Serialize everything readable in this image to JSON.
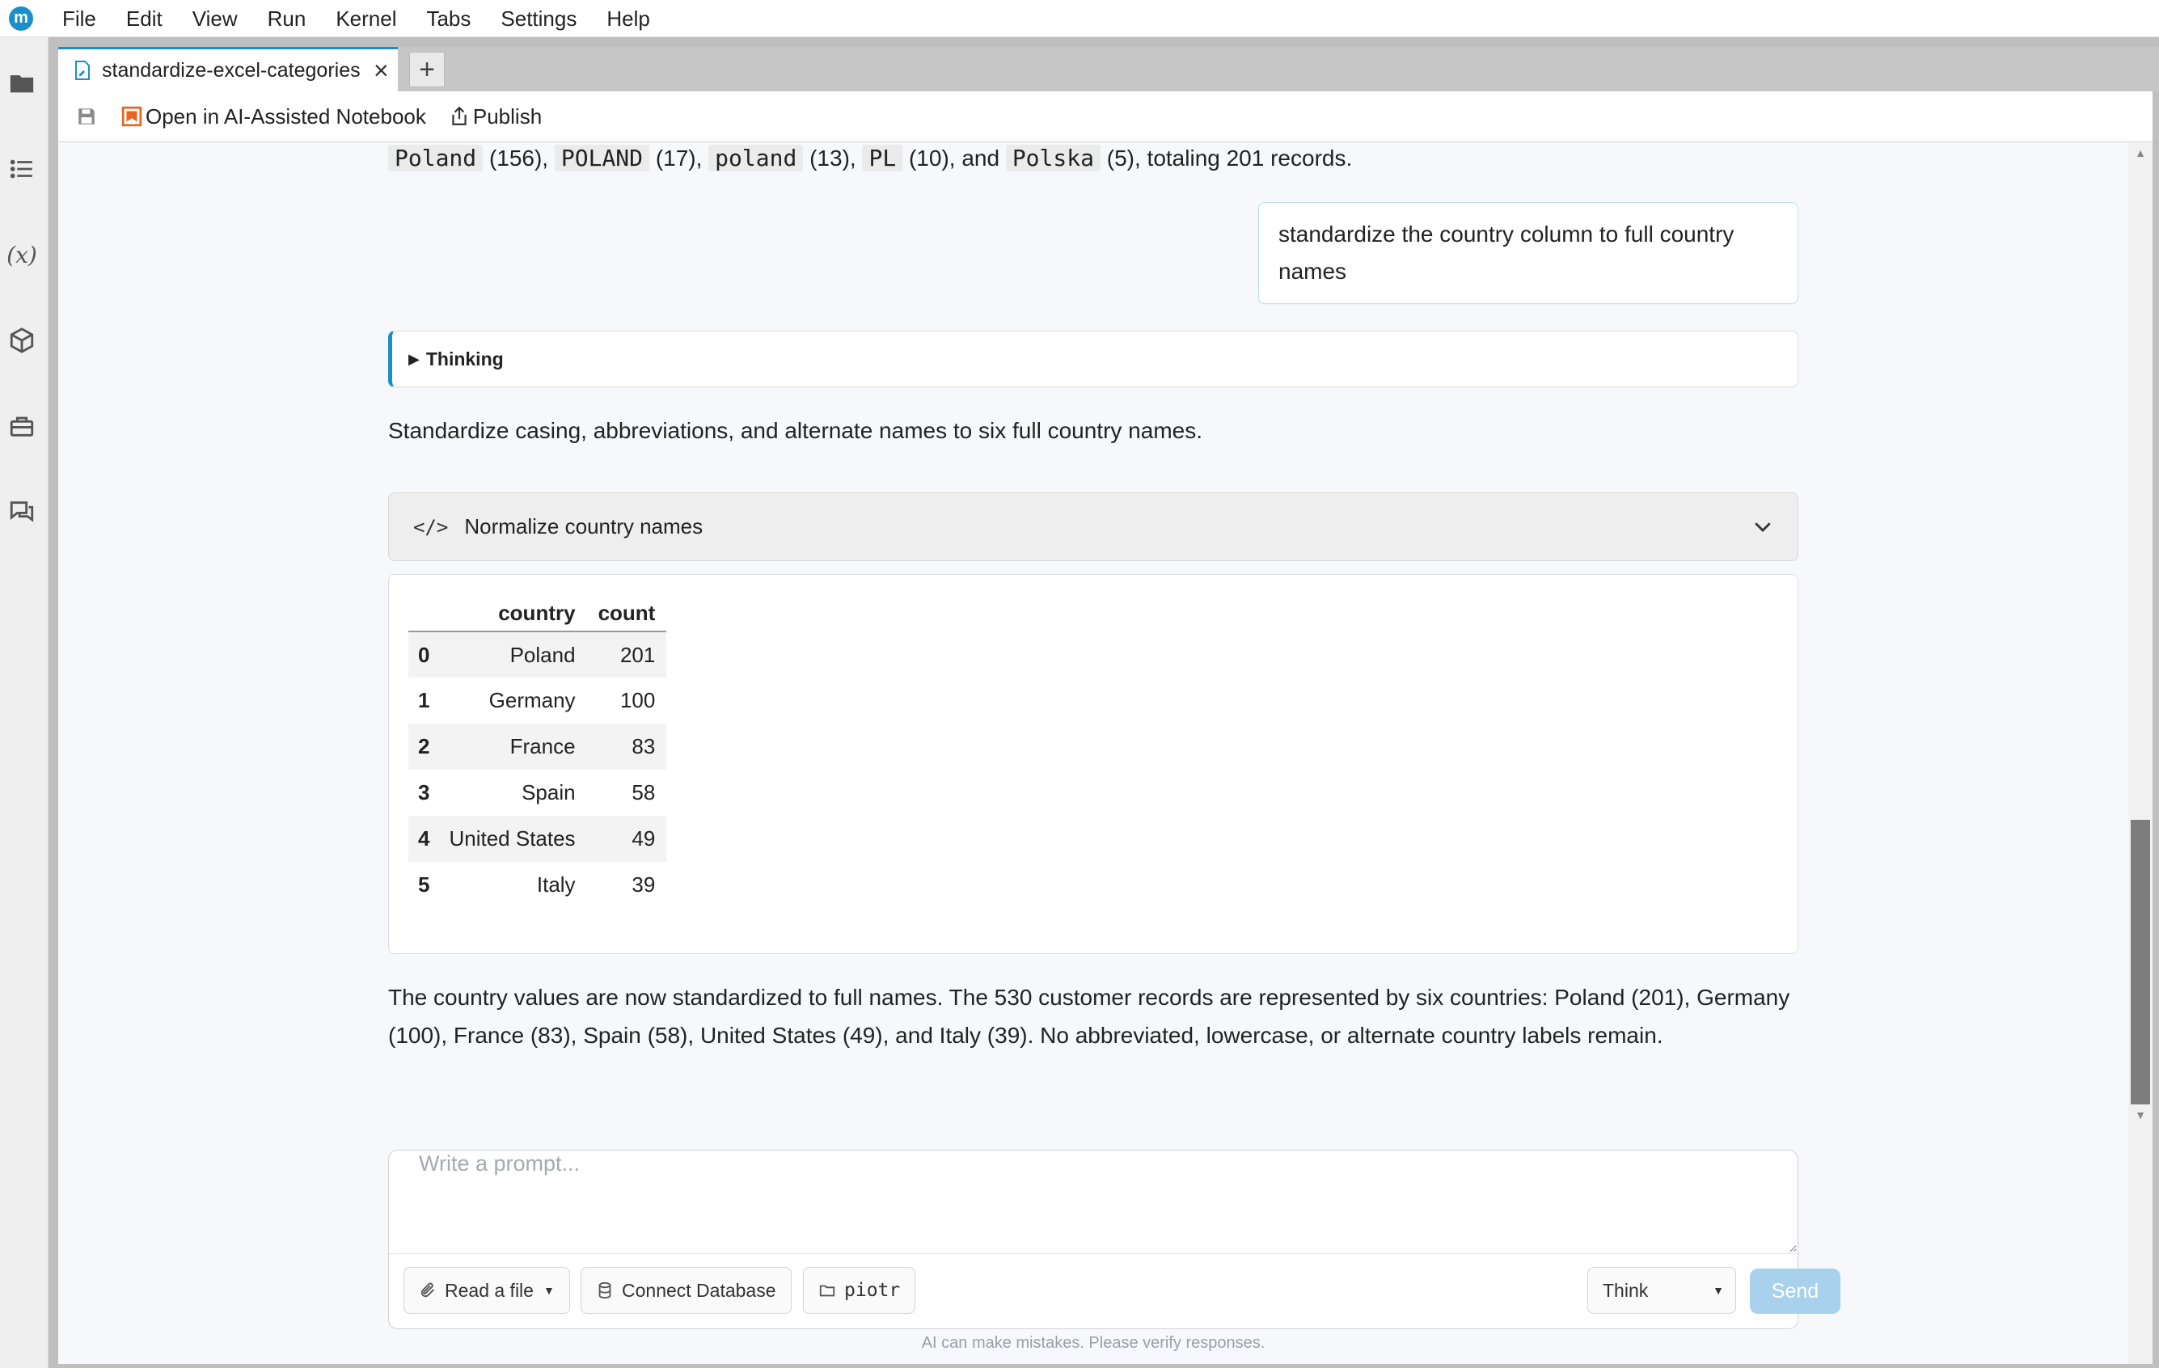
{
  "menu": [
    "File",
    "Edit",
    "View",
    "Run",
    "Kernel",
    "Tabs",
    "Settings",
    "Help"
  ],
  "logo_letter": "m",
  "tab": {
    "label": "standardize-excel-categories",
    "close": "×",
    "add": "+"
  },
  "toolbar": {
    "open_ai": "Open in AI-Assisted Notebook",
    "publish": "Publish"
  },
  "chat": {
    "prev_line": {
      "codes": [
        "Poland",
        "POLAND",
        "poland",
        "PL",
        "Polska"
      ],
      "counts": [
        "(156),",
        "(17),",
        "(13),",
        "(10), and",
        "(5), totaling 201 records."
      ]
    },
    "user_message": "standardize the country column to full country names",
    "thinking_label": "Thinking",
    "summary1": "Standardize casing, abbreviations, and alternate names to six full country names.",
    "code_cell": {
      "icon": "</>",
      "title": "Normalize country names"
    },
    "table": {
      "columns": [
        "country",
        "count"
      ],
      "rows": [
        {
          "index": "0",
          "country": "Poland",
          "count": "201"
        },
        {
          "index": "1",
          "country": "Germany",
          "count": "100"
        },
        {
          "index": "2",
          "country": "France",
          "count": "83"
        },
        {
          "index": "3",
          "country": "Spain",
          "count": "58"
        },
        {
          "index": "4",
          "country": "United States",
          "count": "49"
        },
        {
          "index": "5",
          "country": "Italy",
          "count": "39"
        }
      ]
    },
    "summary2": "The country values are now standardized to full names. The 530 customer records are represented by six countries: Poland (201), Germany (100), France (83), Spain (58), United States (49), and Italy (39). No abbreviated, lowercase, or alternate country labels remain."
  },
  "prompt": {
    "placeholder": "Write a prompt...",
    "read_file": "Read a file",
    "connect_db": "Connect Database",
    "folder": "piotr",
    "mode": "Think",
    "send": "Send",
    "disclaimer": "AI can make mistakes. Please verify responses."
  },
  "colors": {
    "accent": "#1a8fc9",
    "send_disabled": "#a8d1ee"
  },
  "icons": {
    "sidebar": [
      "folder-icon",
      "list-icon",
      "variables-icon",
      "package-icon",
      "briefcase-icon",
      "chat-icon"
    ]
  }
}
